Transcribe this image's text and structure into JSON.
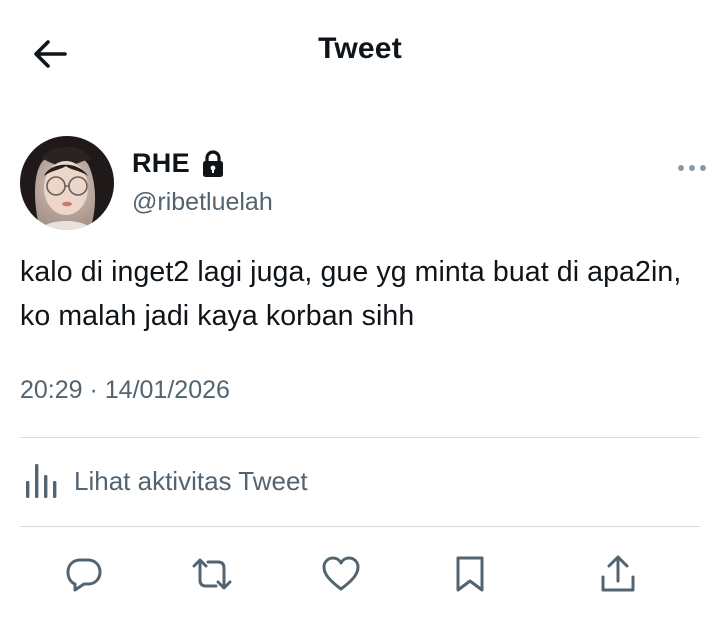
{
  "header": {
    "title": "Tweet",
    "back_icon": "arrow-left-icon"
  },
  "tweet": {
    "author": {
      "name": "RHE",
      "handle": "@ribetluelah",
      "protected_icon": "lock-icon"
    },
    "text": "kalo di inget2 lagi juga, gue yg minta buat di apa2in, ko malah jadi kaya korban sihh",
    "timestamp": "20:29 · 14/01/2026"
  },
  "activity": {
    "label": "Lihat aktivitas Tweet",
    "icon": "analytics-icon"
  },
  "actions": [
    {
      "name": "reply",
      "icon": "reply-icon"
    },
    {
      "name": "retweet",
      "icon": "retweet-icon"
    },
    {
      "name": "like",
      "icon": "heart-icon"
    },
    {
      "name": "bookmark",
      "icon": "bookmark-icon"
    },
    {
      "name": "share",
      "icon": "share-icon"
    }
  ],
  "colors": {
    "text_primary": "#0f1419",
    "text_secondary": "#536471",
    "divider": "#d7dce0",
    "background": "#ffffff"
  }
}
